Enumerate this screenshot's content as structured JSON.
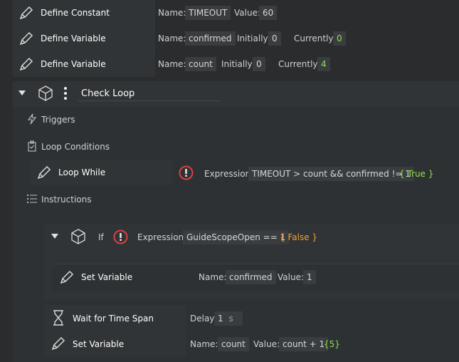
{
  "rows": [
    {
      "title": "Define Constant",
      "name_label": "Name:",
      "name": "TIMEOUT",
      "value_label": "Value:",
      "value": "60"
    },
    {
      "title": "Define Variable",
      "name_label": "Name:",
      "name": "confirmed",
      "init_label": "Initially:",
      "init": "0",
      "curr_label": "Currently:",
      "curr": "0"
    },
    {
      "title": "Define Variable",
      "name_label": "Name:",
      "name": "count",
      "init_label": "Initially:",
      "init": "0",
      "curr_label": "Currently:",
      "curr": "4"
    }
  ],
  "loop": {
    "title": "Check Loop",
    "triggers": "Triggers",
    "conditions": "Loop Conditions",
    "loop_while": "Loop While",
    "expr_label": "Expression:",
    "expr": "TIMEOUT > count && confirmed != 1",
    "expr_result": "{ True }",
    "instructions": "Instructions"
  },
  "if_block": {
    "title": "If",
    "expr_label": "Expression:",
    "expr": "GuideScopeOpen == 1",
    "expr_result": "{ False }",
    "set_title": "Set Variable",
    "name_label": "Name:",
    "name": "confirmed",
    "value_label": "Value:",
    "value": "1"
  },
  "wait": {
    "title": "Wait for Time Span",
    "delay_label": "Delay",
    "delay": "1",
    "unit": "s"
  },
  "set2": {
    "title": "Set Variable",
    "name_label": "Name:",
    "name": "count",
    "value_label": "Value:",
    "value": "count + 1",
    "result": "{5}"
  },
  "colors": {
    "accent_green": "#8fe04a",
    "accent_orange": "#f0a030",
    "error_red": "#d94040"
  }
}
